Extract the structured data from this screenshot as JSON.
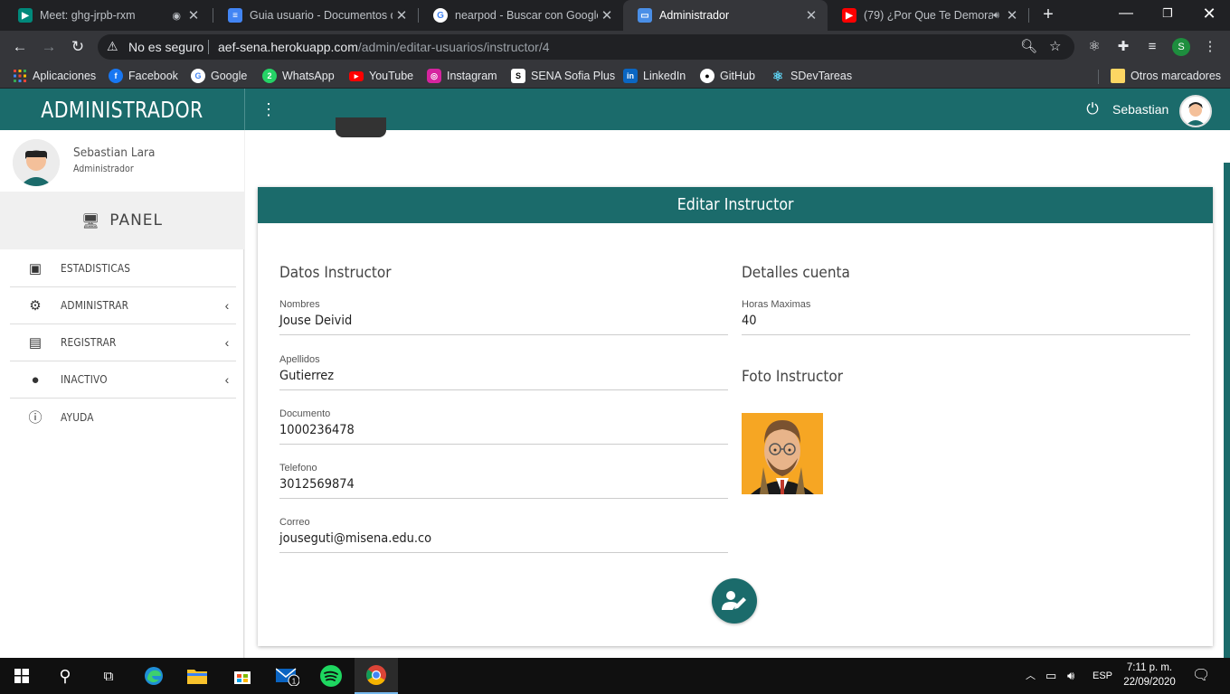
{
  "browser": {
    "tabs": [
      {
        "title": "Meet: ghg-jrpb-rxm",
        "icon": "meet-icon",
        "color": "#00897b"
      },
      {
        "title": "Guia usuario - Documentos de",
        "icon": "docs-icon",
        "color": "#4285f4"
      },
      {
        "title": "nearpod - Buscar con Google",
        "icon": "google-icon",
        "color": "#ffffff"
      },
      {
        "title": "Administrador",
        "icon": "page-icon",
        "color": "#4a8fe7",
        "active": true
      },
      {
        "title": "(79) ¿Por Que Te Demoras",
        "icon": "youtube-icon",
        "color": "#ff0000"
      }
    ],
    "new_tab": "+",
    "address": {
      "security": "No es seguro",
      "host": "aef-sena.herokuapp.com",
      "path": "/admin/editar-usuarios/instructor/4"
    },
    "profile_initial": "S",
    "bookmarks": [
      {
        "label": "Aplicaciones",
        "icon": "apps-grid-icon"
      },
      {
        "label": "Facebook",
        "icon": "facebook-icon",
        "color": "#1877f2"
      },
      {
        "label": "Google",
        "icon": "google-icon",
        "color": "#ffffff"
      },
      {
        "label": "WhatsApp",
        "icon": "whatsapp-icon",
        "color": "#25d366"
      },
      {
        "label": "YouTube",
        "icon": "youtube-icon",
        "color": "#ff0000"
      },
      {
        "label": "Instagram",
        "icon": "instagram-icon",
        "color": "#d6249f"
      },
      {
        "label": "SENA Sofia Plus",
        "icon": "sena-icon",
        "color": "#ffffff"
      },
      {
        "label": "LinkedIn",
        "icon": "linkedin-icon",
        "color": "#0a66c2"
      },
      {
        "label": "GitHub",
        "icon": "github-icon",
        "color": "#ffffff"
      },
      {
        "label": "SDevTareas",
        "icon": "react-icon",
        "color": "#61dafb"
      }
    ],
    "other_bookmarks": "Otros marcadores"
  },
  "app": {
    "brand": "ADMINISTRADOR",
    "topbar_user": "Sebastian",
    "accent": "#1b6b6b",
    "sidebar": {
      "user_name": "Sebastian Lara",
      "user_role": "Administrador",
      "panel": "PANEL",
      "items": [
        {
          "label": "ESTADISTICAS",
          "icon": "stats-book-icon",
          "has_submenu": false
        },
        {
          "label": "ADMINISTRAR",
          "icon": "users-cog-icon",
          "has_submenu": true
        },
        {
          "label": "REGISTRAR",
          "icon": "id-card-icon",
          "has_submenu": true
        },
        {
          "label": "INACTIVO",
          "icon": "inactive-icon",
          "has_submenu": true
        },
        {
          "label": "AYUDA",
          "icon": "info-icon",
          "has_submenu": false
        }
      ]
    },
    "card": {
      "title": "Editar Instructor",
      "left_section": "Datos Instructor",
      "right_section": "Detalles cuenta",
      "photo_section": "Foto Instructor",
      "fields": {
        "nombres": {
          "label": "Nombres",
          "value": "Jouse Deivid"
        },
        "apellidos": {
          "label": "Apellidos",
          "value": "Gutierrez"
        },
        "documento": {
          "label": "Documento",
          "value": "1000236478"
        },
        "telefono": {
          "label": "Telefono",
          "value": "3012569874"
        },
        "correo": {
          "label": "Correo",
          "value": "jouseguti@misena.edu.co"
        },
        "horas": {
          "label": "Horas Maximas",
          "value": "40"
        }
      }
    }
  },
  "taskbar": {
    "language": "ESP",
    "time": "7:11 p. m.",
    "date": "22/09/2020",
    "mail_badge": "1"
  }
}
